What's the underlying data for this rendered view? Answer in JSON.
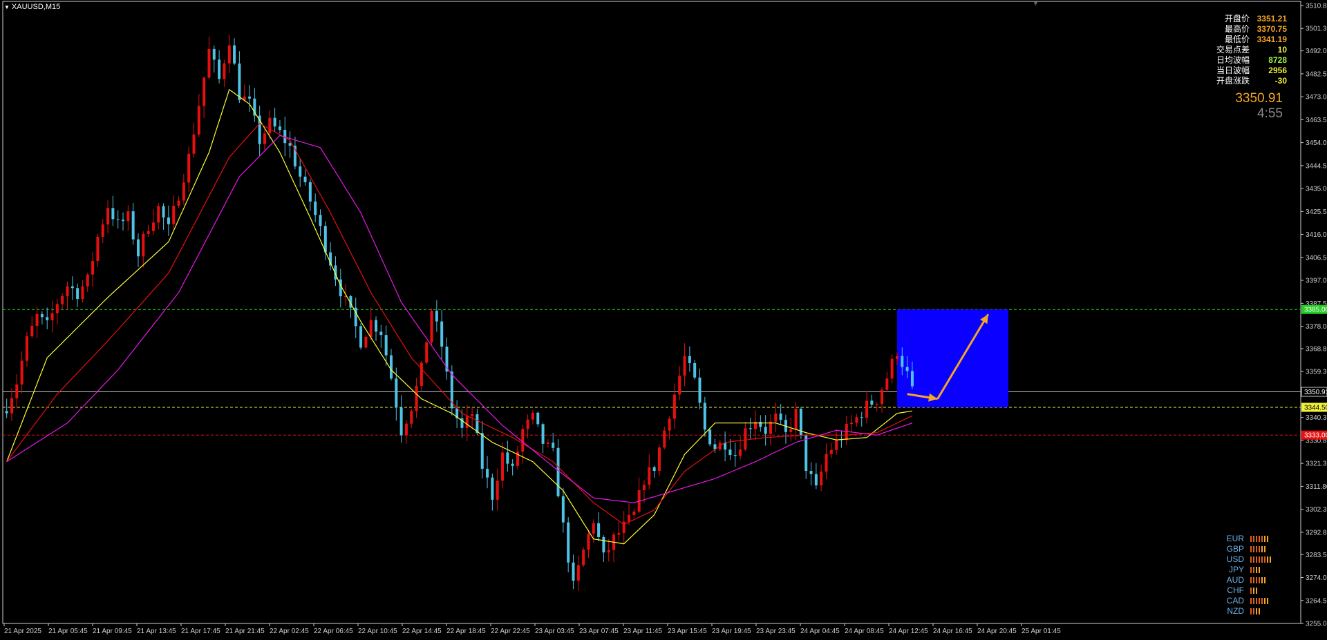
{
  "header": {
    "symbol": "XAUUSD,M15"
  },
  "stats": [
    {
      "label": "开盘价",
      "value": "3351.21",
      "color": "#f5a623"
    },
    {
      "label": "最高价",
      "value": "3370.75",
      "color": "#f5a623"
    },
    {
      "label": "最低价",
      "value": "3341.19",
      "color": "#f5a623"
    },
    {
      "label": "交易点差",
      "value": "10",
      "color": "#f2f23a"
    },
    {
      "label": "日均波幅",
      "value": "8728",
      "color": "#9ef23a"
    },
    {
      "label": "当日波幅",
      "value": "2956",
      "color": "#f2f23a"
    },
    {
      "label": "开盘涨跌",
      "value": "-30",
      "color": "#f2f23a"
    }
  ],
  "current": {
    "price": "3350.91",
    "timer": "4:55"
  },
  "currencies": [
    {
      "name": "EUR",
      "strength": 7
    },
    {
      "name": "GBP",
      "strength": 6
    },
    {
      "name": "USD",
      "strength": 8
    },
    {
      "name": "JPY",
      "strength": 4
    },
    {
      "name": "AUD",
      "strength": 6
    },
    {
      "name": "CHF",
      "strength": 3
    },
    {
      "name": "CAD",
      "strength": 7
    },
    {
      "name": "NZD",
      "strength": 4
    }
  ],
  "chart_data": {
    "type": "candlestick",
    "symbol": "XAUUSD",
    "timeframe": "M15",
    "ylim": [
      3255.05,
      3510.8
    ],
    "y_ticks": [
      "3510.80",
      "3501.30",
      "3492.05",
      "3482.55",
      "3473.05",
      "3463.55",
      "3454.05",
      "3444.55",
      "3435.05",
      "3425.55",
      "3416.05",
      "3406.55",
      "3397.05",
      "3387.55",
      "3378.05",
      "3368.80",
      "3359.30",
      "3340.30",
      "3330.80",
      "3321.30",
      "3311.80",
      "3302.30",
      "3292.80",
      "3283.55",
      "3274.05",
      "3264.55",
      "3255.05"
    ],
    "x_ticks": [
      "21 Apr 2025",
      "21 Apr 05:45",
      "21 Apr 09:45",
      "21 Apr 13:45",
      "21 Apr 17:45",
      "21 Apr 21:45",
      "22 Apr 02:45",
      "22 Apr 06:45",
      "22 Apr 10:45",
      "22 Apr 14:45",
      "22 Apr 18:45",
      "22 Apr 22:45",
      "23 Apr 03:45",
      "23 Apr 07:45",
      "23 Apr 11:45",
      "23 Apr 15:45",
      "23 Apr 19:45",
      "23 Apr 23:45",
      "24 Apr 04:45",
      "24 Apr 08:45",
      "24 Apr 12:45",
      "24 Apr 16:45",
      "24 Apr 20:45",
      "25 Apr 01:45"
    ],
    "price_path": [
      [
        0,
        3345
      ],
      [
        2,
        3355
      ],
      [
        4,
        3372
      ],
      [
        6,
        3382
      ],
      [
        8,
        3378
      ],
      [
        10,
        3388
      ],
      [
        12,
        3395
      ],
      [
        14,
        3392
      ],
      [
        16,
        3397
      ],
      [
        18,
        3415
      ],
      [
        20,
        3428
      ],
      [
        22,
        3420
      ],
      [
        24,
        3423
      ],
      [
        26,
        3408
      ],
      [
        28,
        3420
      ],
      [
        30,
        3427
      ],
      [
        32,
        3418
      ],
      [
        34,
        3433
      ],
      [
        36,
        3448
      ],
      [
        38,
        3470
      ],
      [
        40,
        3492
      ],
      [
        42,
        3480
      ],
      [
        44,
        3497
      ],
      [
        46,
        3474
      ],
      [
        48,
        3470
      ],
      [
        50,
        3455
      ],
      [
        52,
        3462
      ],
      [
        54,
        3458
      ],
      [
        56,
        3452
      ],
      [
        58,
        3440
      ],
      [
        60,
        3430
      ],
      [
        62,
        3418
      ],
      [
        64,
        3405
      ],
      [
        66,
        3393
      ],
      [
        68,
        3383
      ],
      [
        70,
        3372
      ],
      [
        72,
        3380
      ],
      [
        74,
        3376
      ],
      [
        76,
        3357
      ],
      [
        78,
        3335
      ],
      [
        80,
        3345
      ],
      [
        82,
        3360
      ],
      [
        84,
        3385
      ],
      [
        86,
        3370
      ],
      [
        88,
        3345
      ],
      [
        90,
        3335
      ],
      [
        92,
        3342
      ],
      [
        94,
        3320
      ],
      [
        96,
        3308
      ],
      [
        98,
        3325
      ],
      [
        100,
        3318
      ],
      [
        102,
        3335
      ],
      [
        104,
        3340
      ],
      [
        106,
        3330
      ],
      [
        108,
        3325
      ],
      [
        110,
        3295
      ],
      [
        112,
        3270
      ],
      [
        114,
        3285
      ],
      [
        116,
        3298
      ],
      [
        118,
        3282
      ],
      [
        120,
        3290
      ],
      [
        122,
        3295
      ],
      [
        124,
        3300
      ],
      [
        126,
        3315
      ],
      [
        128,
        3320
      ],
      [
        130,
        3335
      ],
      [
        132,
        3350
      ],
      [
        134,
        3365
      ],
      [
        136,
        3355
      ],
      [
        138,
        3335
      ],
      [
        140,
        3328
      ],
      [
        142,
        3330
      ],
      [
        144,
        3325
      ],
      [
        146,
        3335
      ],
      [
        148,
        3340
      ],
      [
        150,
        3335
      ],
      [
        152,
        3340
      ],
      [
        154,
        3333
      ],
      [
        156,
        3342
      ],
      [
        158,
        3320
      ],
      [
        160,
        3310
      ],
      [
        162,
        3325
      ],
      [
        164,
        3330
      ],
      [
        166,
        3335
      ],
      [
        168,
        3340
      ],
      [
        170,
        3345
      ],
      [
        172,
        3348
      ],
      [
        174,
        3357
      ],
      [
        176,
        3368
      ],
      [
        178,
        3358
      ],
      [
        179,
        3351
      ]
    ],
    "moving_averages": [
      {
        "color": "#ffff33",
        "values": [
          [
            0,
            3322
          ],
          [
            8,
            3365
          ],
          [
            20,
            3390
          ],
          [
            32,
            3413
          ],
          [
            40,
            3450
          ],
          [
            44,
            3476
          ],
          [
            48,
            3470
          ],
          [
            54,
            3450
          ],
          [
            60,
            3423
          ],
          [
            66,
            3395
          ],
          [
            70,
            3380
          ],
          [
            76,
            3360
          ],
          [
            82,
            3348
          ],
          [
            88,
            3342
          ],
          [
            96,
            3330
          ],
          [
            104,
            3322
          ],
          [
            110,
            3310
          ],
          [
            116,
            3290
          ],
          [
            122,
            3288
          ],
          [
            128,
            3300
          ],
          [
            134,
            3325
          ],
          [
            140,
            3338
          ],
          [
            146,
            3338
          ],
          [
            152,
            3338
          ],
          [
            158,
            3334
          ],
          [
            164,
            3331
          ],
          [
            170,
            3332
          ],
          [
            176,
            3342
          ],
          [
            179,
            3343
          ]
        ]
      },
      {
        "color": "#e61010",
        "values": [
          [
            0,
            3322
          ],
          [
            10,
            3350
          ],
          [
            20,
            3372
          ],
          [
            32,
            3400
          ],
          [
            44,
            3448
          ],
          [
            50,
            3462
          ],
          [
            56,
            3455
          ],
          [
            64,
            3425
          ],
          [
            72,
            3392
          ],
          [
            80,
            3365
          ],
          [
            90,
            3342
          ],
          [
            100,
            3332
          ],
          [
            108,
            3322
          ],
          [
            116,
            3305
          ],
          [
            122,
            3296
          ],
          [
            128,
            3302
          ],
          [
            134,
            3318
          ],
          [
            142,
            3330
          ],
          [
            150,
            3332
          ],
          [
            158,
            3333
          ],
          [
            166,
            3333
          ],
          [
            172,
            3334
          ],
          [
            179,
            3341
          ]
        ]
      },
      {
        "color": "#e619e6",
        "values": [
          [
            0,
            3322
          ],
          [
            12,
            3338
          ],
          [
            22,
            3360
          ],
          [
            34,
            3392
          ],
          [
            46,
            3440
          ],
          [
            54,
            3457
          ],
          [
            62,
            3452
          ],
          [
            70,
            3425
          ],
          [
            78,
            3388
          ],
          [
            88,
            3358
          ],
          [
            98,
            3337
          ],
          [
            108,
            3320
          ],
          [
            116,
            3307
          ],
          [
            124,
            3305
          ],
          [
            132,
            3310
          ],
          [
            140,
            3315
          ],
          [
            148,
            3322
          ],
          [
            156,
            3330
          ],
          [
            164,
            3335
          ],
          [
            172,
            3333
          ],
          [
            179,
            3338
          ]
        ]
      }
    ],
    "hlines": [
      {
        "value": 3385.0,
        "color": "#22cc22",
        "style": "dashed",
        "label": "3385.00"
      },
      {
        "value": 3350.91,
        "color": "#c0c0c0",
        "style": "solid",
        "label": "3350.91"
      },
      {
        "value": 3344.5,
        "color": "#f2f23a",
        "style": "dashed",
        "label": "3344.50"
      },
      {
        "value": 3333.0,
        "color": "#e61010",
        "style": "dashed",
        "label": "3333.00"
      }
    ],
    "box": {
      "x0": 176,
      "x1": 198,
      "y_low": 3344.5,
      "y_high": 3385.0,
      "color": "#0a00ff"
    },
    "arrows": [
      {
        "from": [
          178,
          3350
        ],
        "to": [
          184,
          3348
        ],
        "color": "#f5a623"
      },
      {
        "from": [
          184,
          3348
        ],
        "to": [
          194,
          3383
        ],
        "color": "#f5a623"
      }
    ]
  }
}
